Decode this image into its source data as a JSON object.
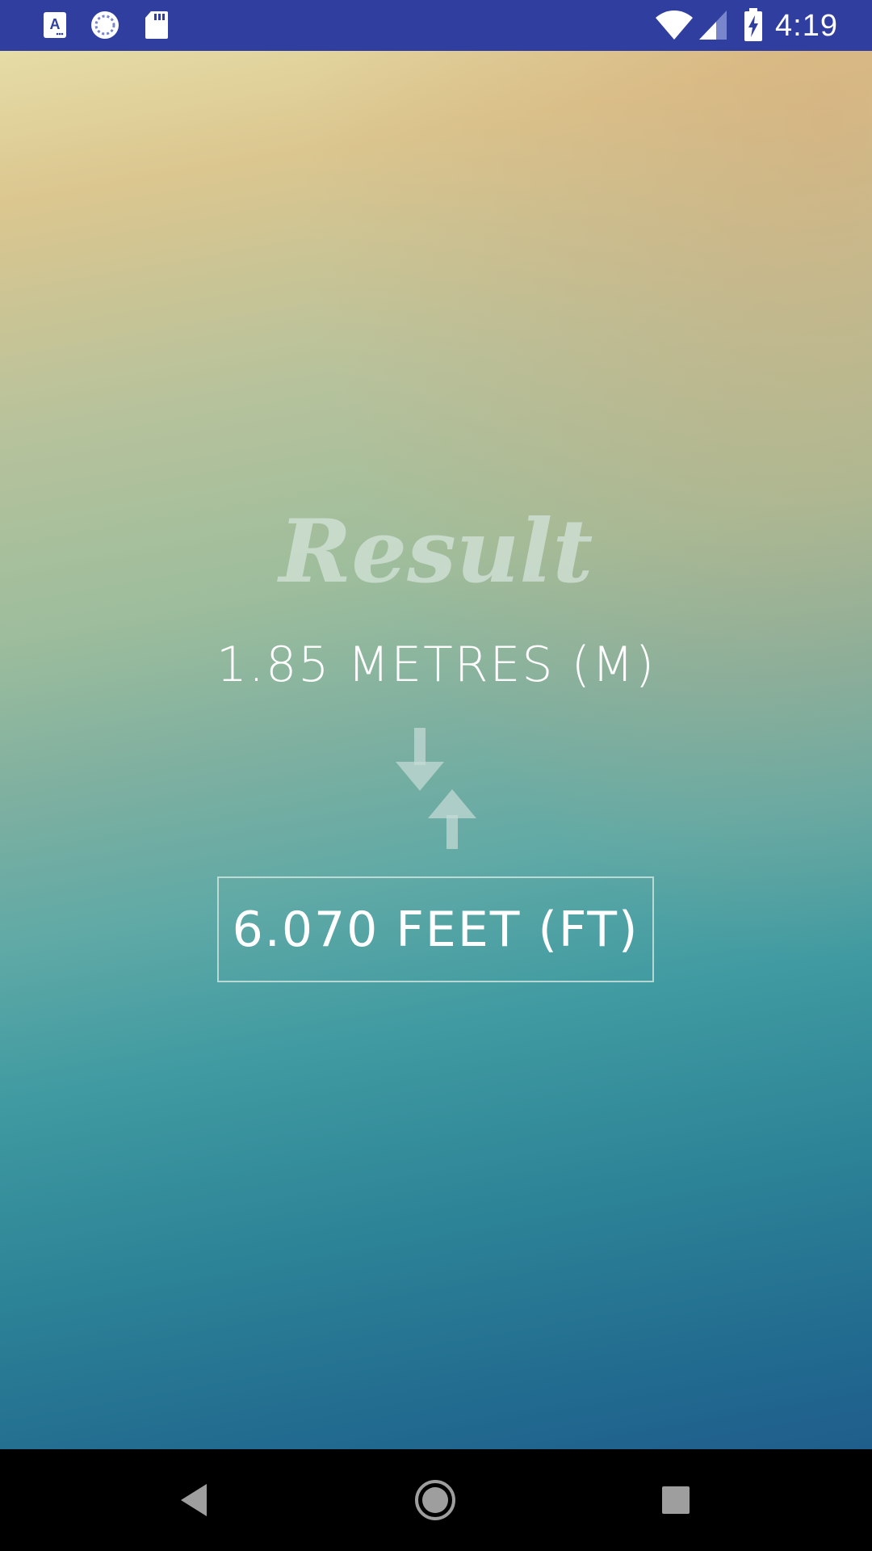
{
  "status_bar": {
    "time": "4:19",
    "icons": [
      "app-notification-icon",
      "sync-icon",
      "sd-card-icon",
      "wifi-icon",
      "cell-signal-icon",
      "battery-charging-icon"
    ],
    "background": "#303f9f"
  },
  "result": {
    "title": "Result",
    "source_value": "1.85 METRES (M)",
    "converted_value": "6.070 FEET (FT)",
    "swap_icon": "swap-vertical-arrows-icon"
  },
  "nav_bar": {
    "buttons": [
      "back-icon",
      "home-icon",
      "recents-icon"
    ]
  },
  "colors": {
    "gradient_top": "#e6dca6",
    "gradient_bottom": "#1f5e8c",
    "text": "#ffffff"
  }
}
